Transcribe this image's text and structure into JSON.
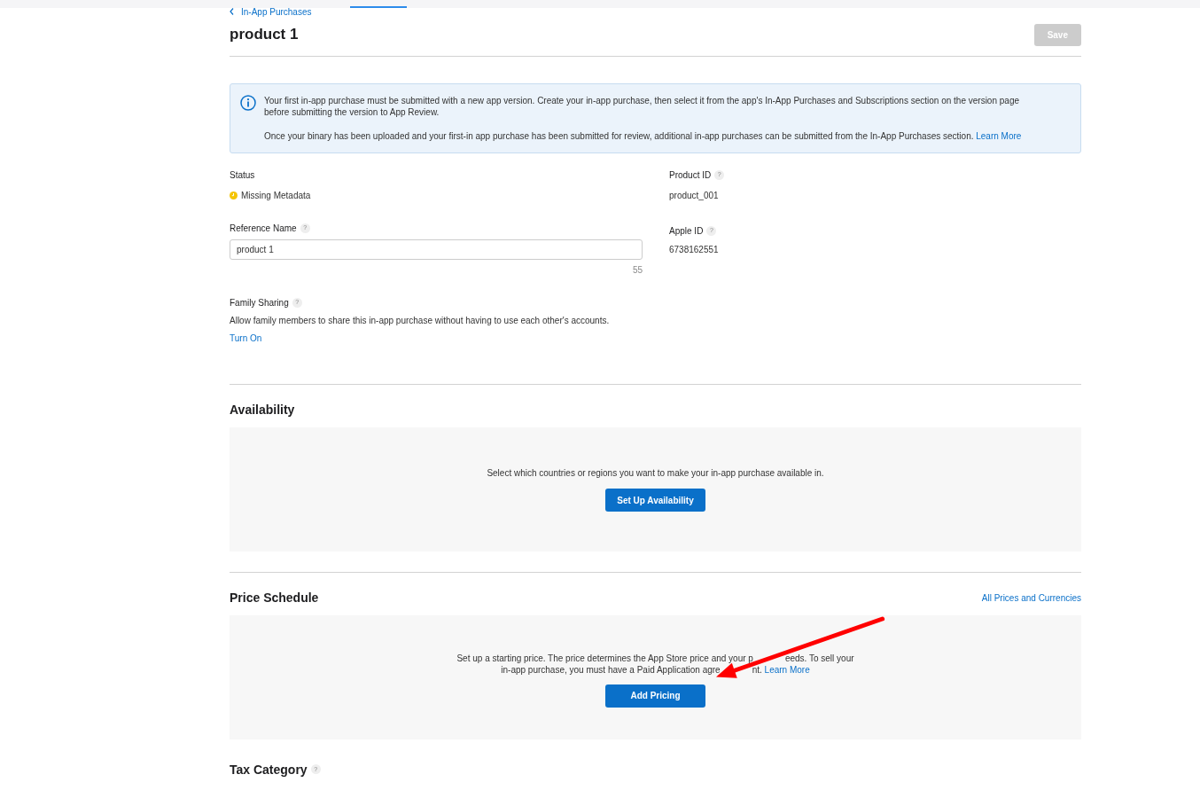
{
  "breadcrumb": {
    "label": "In-App Purchases"
  },
  "title": "product 1",
  "save_button": {
    "label": "Save",
    "disabled": true
  },
  "notice": {
    "paragraphs": [
      "Your first in-app purchase must be submitted with a new app version. Create your in-app purchase, then select it from the app's In-App Purchases and Subscriptions section on the version page before submitting the version to App Review.",
      "Once your binary has been uploaded and your first-in app purchase has been submitted for review, additional in-app purchases can be submitted from the In-App Purchases section."
    ],
    "link": "Learn More"
  },
  "status": {
    "label": "Status",
    "value": "Missing Metadata"
  },
  "product_id": {
    "label": "Product ID",
    "help": "?",
    "value": "product_001"
  },
  "reference_name": {
    "label": "Reference Name",
    "help": "?",
    "value": "product 1",
    "counter": "55"
  },
  "apple_id": {
    "label": "Apple ID",
    "help": "?",
    "value": "6738162551"
  },
  "family_sharing": {
    "label": "Family Sharing",
    "help": "?",
    "description": "Allow family members to share this in-app purchase without having to use each other's accounts.",
    "link": "Turn On"
  },
  "availability": {
    "heading": "Availability",
    "text": "Select which countries or regions you want to make your in-app purchase available in.",
    "button": "Set Up Availability"
  },
  "price_schedule": {
    "heading": "Price Schedule",
    "link": "All Prices and Currencies",
    "text_lines": [
      [
        "Set up a starting price. The price determines the App Store price and your p",
        "eeds. To sell your"
      ],
      [
        "in-app purchase, you must have a Paid Application agre",
        "nt."
      ]
    ],
    "text_link": "Learn More",
    "button": "Add Pricing"
  },
  "tax_category": {
    "heading": "Tax Category",
    "help": "?"
  }
}
